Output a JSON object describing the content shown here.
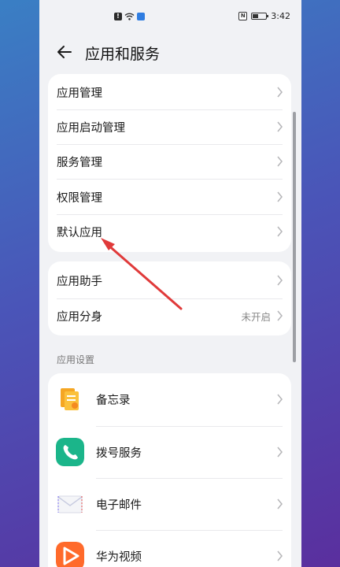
{
  "status": {
    "time": "3:42",
    "nfc_label": "N"
  },
  "header": {
    "title": "应用和服务",
    "back_icon": "arrow-left-icon"
  },
  "group1": [
    {
      "label": "应用管理"
    },
    {
      "label": "应用启动管理"
    },
    {
      "label": "服务管理"
    },
    {
      "label": "权限管理"
    },
    {
      "label": "默认应用"
    }
  ],
  "group2": [
    {
      "label": "应用助手",
      "value": ""
    },
    {
      "label": "应用分身",
      "value": "未开启"
    }
  ],
  "section": {
    "title": "应用设置"
  },
  "apps": [
    {
      "label": "备忘录",
      "icon": "notepad-icon"
    },
    {
      "label": "拨号服务",
      "icon": "phone-icon"
    },
    {
      "label": "电子邮件",
      "icon": "mail-icon"
    },
    {
      "label": "华为视频",
      "icon": "video-play-icon"
    }
  ],
  "colors": {
    "annotation_arrow": "#e03a3a",
    "phone_green": "#1bb58a",
    "video_orange": "#ff6a2b",
    "notes_orange": "#f7a21b"
  }
}
